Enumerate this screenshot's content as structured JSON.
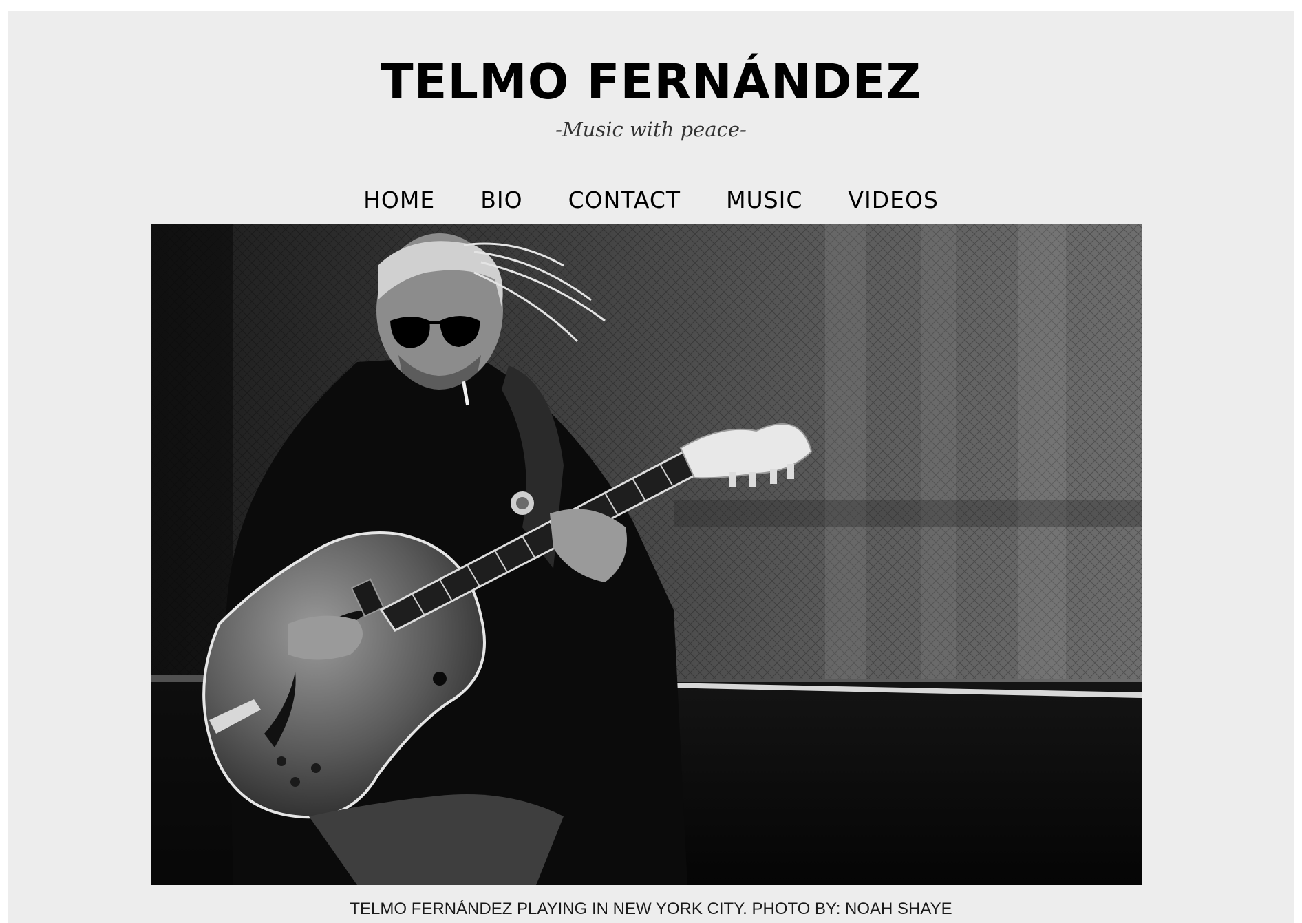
{
  "site": {
    "title": "TELMO FERNÁNDEZ",
    "tagline": "-Music with peace-"
  },
  "nav": {
    "items": [
      {
        "label": "HOME"
      },
      {
        "label": "BIO"
      },
      {
        "label": "CONTACT"
      },
      {
        "label": "MUSIC"
      },
      {
        "label": "VIDEOS"
      }
    ]
  },
  "hero": {
    "caption": "TELMO FERNÁNDEZ PLAYING IN NEW YORK CITY. PHOTO BY: NOAH SHAYE"
  },
  "colors": {
    "page_background": "#ededed",
    "text": "#000000"
  }
}
